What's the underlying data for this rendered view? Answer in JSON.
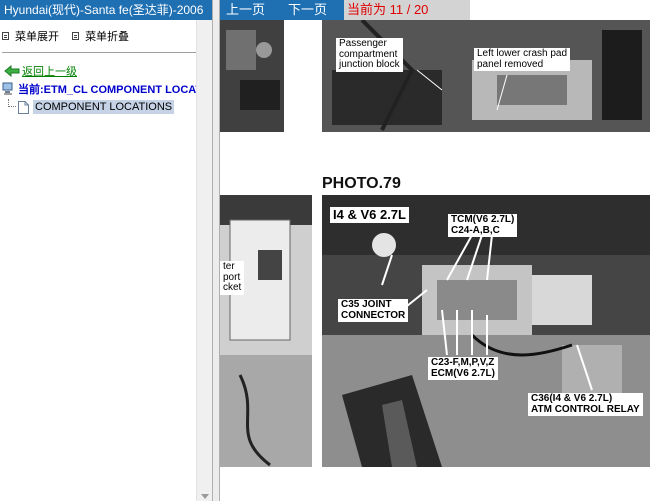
{
  "left": {
    "title": "Hyundai(现代)-Santa fe(圣达菲)-2006",
    "menu": {
      "expand": "菜单展开",
      "collapse": "菜单折叠"
    },
    "back_link": "返回上一级",
    "current": "当前:ETM_CL COMPONENT LOCATIONS",
    "selected_item": "COMPONENT LOCATIONS"
  },
  "nav": {
    "prev": "上一页",
    "next": "下一页",
    "current_page": "当前为 11 / 20"
  },
  "doc": {
    "top_photo_labels": {
      "passenger_jb": "Passenger\ncompartment\njunction block",
      "crash_pad": "Left lower crash pad\npanel removed"
    },
    "photo_title": "PHOTO.79",
    "left_photo_label": "ter\nport\ncket",
    "photo_labels": {
      "engine": "I4 & V6 2.7L",
      "tcm": "TCM(V6 2.7L)\nC24-A,B,C",
      "c35": "C35 JOINT\nCONNECTOR",
      "c23": "C23-F,M,P,V,Z\nECM(V6 2.7L)",
      "c36": "C36(I4 & V6 2.7L)\nATM CONTROL RELAY"
    }
  },
  "colors": {
    "title_bar": "#1f6fb3",
    "current_page_text": "#e00000",
    "back_link": "#008000",
    "current_text": "#0000cc",
    "selection": "#c6d3e6"
  }
}
